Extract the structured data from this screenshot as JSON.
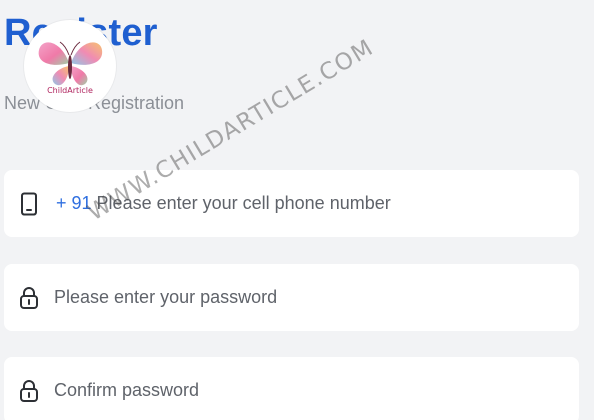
{
  "header": {
    "title": "Register",
    "subtitle": "New User Registration"
  },
  "form": {
    "phone": {
      "prefix": "+ 91",
      "placeholder": "Please enter your cell phone number"
    },
    "password": {
      "placeholder": "Please enter your password"
    },
    "confirm_password": {
      "placeholder": "Confirm password"
    }
  },
  "watermark": {
    "logo_text": "ChildArticle",
    "text": "WWW.CHILDARTICLE.COM"
  },
  "colors": {
    "title": "#1f5fd0",
    "prefix": "#2f6fe0",
    "background": "#f2f3f5",
    "field": "#ffffff"
  },
  "icons": {
    "phone": "phone-icon",
    "password": "lock-icon",
    "confirm_password": "lock-icon"
  }
}
